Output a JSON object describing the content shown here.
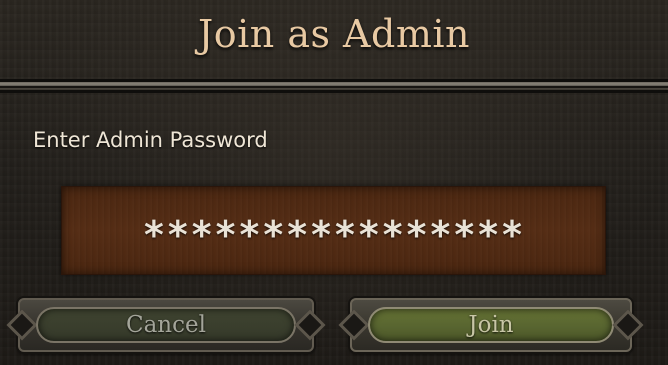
{
  "dialog": {
    "title": "Join as Admin",
    "password_label": "Enter Admin Password",
    "password_value": "****************",
    "cancel_label": "Cancel",
    "join_label": "Join"
  },
  "colors": {
    "title": "#e8c9a3",
    "field_background": "#552d15",
    "join_button": "#657234",
    "cancel_button": "#3f4430"
  }
}
